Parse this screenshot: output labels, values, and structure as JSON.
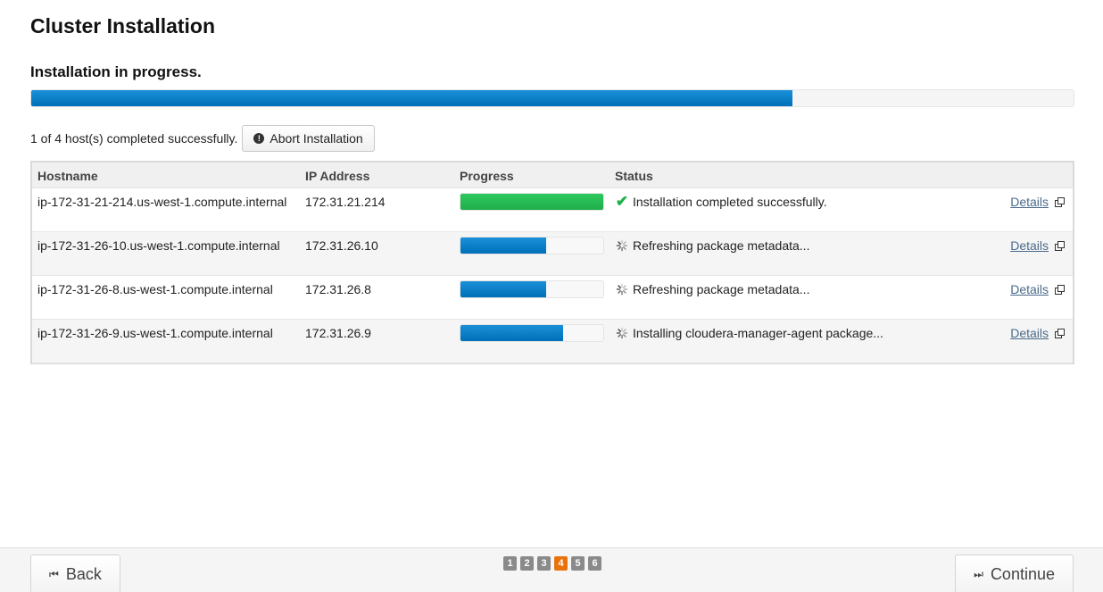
{
  "page": {
    "title": "Cluster Installation",
    "subtitle": "Installation in progress.",
    "overall_progress_percent": 73
  },
  "summary": {
    "text": "1 of 4 host(s) completed successfully.",
    "abort_label": "Abort Installation",
    "abort_icon": "exclamation-circle-icon"
  },
  "table": {
    "headers": [
      "Hostname",
      "IP Address",
      "Progress",
      "Status"
    ],
    "rows": [
      {
        "hostname": "ip-172-31-21-214.us-west-1.compute.internal",
        "ip": "172.31.21.214",
        "progress_percent": 100,
        "state": "done",
        "status": "Installation completed successfully.",
        "details": "Details"
      },
      {
        "hostname": "ip-172-31-26-10.us-west-1.compute.internal",
        "ip": "172.31.26.10",
        "progress_percent": 60,
        "state": "running",
        "status": "Refreshing package metadata...",
        "details": "Details"
      },
      {
        "hostname": "ip-172-31-26-8.us-west-1.compute.internal",
        "ip": "172.31.26.8",
        "progress_percent": 60,
        "state": "running",
        "status": "Refreshing package metadata...",
        "details": "Details"
      },
      {
        "hostname": "ip-172-31-26-9.us-west-1.compute.internal",
        "ip": "172.31.26.9",
        "progress_percent": 72,
        "state": "running",
        "status": "Installing cloudera-manager-agent package...",
        "details": "Details"
      }
    ]
  },
  "footer": {
    "back_label": "Back",
    "continue_label": "Continue",
    "steps": [
      "1",
      "2",
      "3",
      "4",
      "5",
      "6"
    ],
    "active_step": "4"
  },
  "colors": {
    "progress_blue": "#0a7fc8",
    "progress_green": "#24b44f",
    "active_step": "#e8720c",
    "inactive_step": "#8a8a8a"
  }
}
